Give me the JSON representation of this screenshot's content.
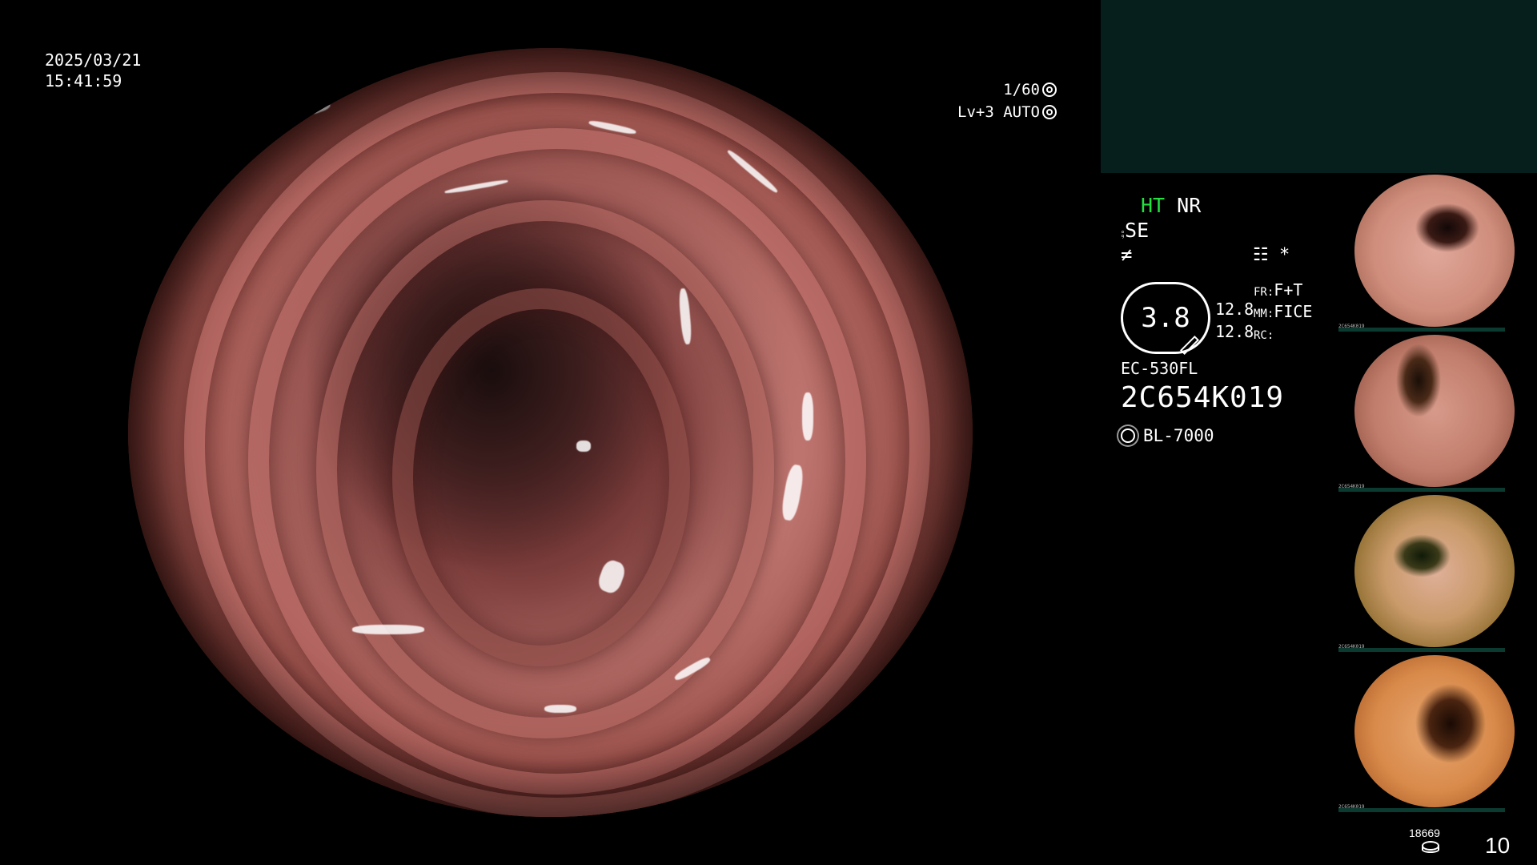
{
  "datetime": {
    "date": "2025/03/21",
    "time": "15:41:59"
  },
  "exposure": {
    "shutter": "1/60",
    "shutter_icon": "shutter-icon",
    "level": "Lv+3 AUTO",
    "auto_icon": "iris-icon"
  },
  "status": {
    "ht": "HT",
    "nr": "NR",
    "se": "SE",
    "se_icon": "enhancement-icon",
    "lightning_icon": "signal-icon",
    "menu_icon": "settings-icon",
    "star": "*",
    "zoom_value": "3.8",
    "val1": "12.8",
    "val2": "12.8",
    "fr_label": "FR:",
    "fr_value": "F+T",
    "mm_label": "MM:",
    "mm_value": "FICE",
    "rc_label": "RC:",
    "scope_model": "EC-530FL",
    "scope_serial": "2C654K019",
    "light_icon": "light-source-icon",
    "light_source": "BL-7000"
  },
  "thumbnails": [
    {
      "serial": "2C654K019"
    },
    {
      "serial": "2C654K019"
    },
    {
      "serial": "2C654K019"
    },
    {
      "serial": "2C654K019"
    }
  ],
  "storage": {
    "remaining": "18669",
    "icon": "storage-icon",
    "count": "10"
  },
  "colors": {
    "top_box": "#061e1c",
    "ht_green": "#22e040",
    "thumb_bar": "#0b3a30"
  }
}
